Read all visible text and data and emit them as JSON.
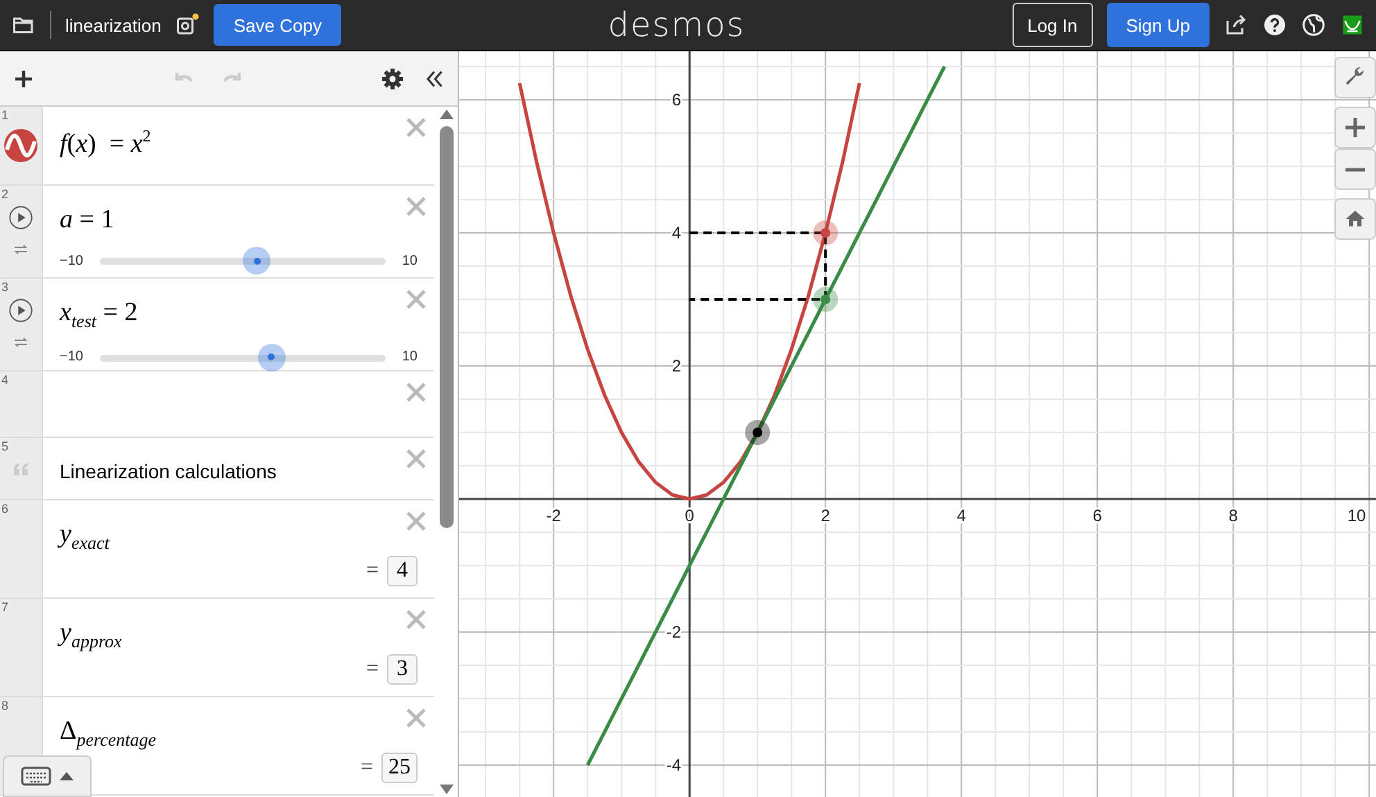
{
  "header": {
    "title": "linearization",
    "save_button": "Save Copy",
    "logo": "desmos",
    "login_button": "Log In",
    "signup_button": "Sign Up"
  },
  "expressions": [
    {
      "kind": "function",
      "number": "1",
      "expr": "*f*(*x*)  = *x*$^{2}$",
      "color": "#c74440"
    },
    {
      "kind": "slider",
      "number": "2",
      "expr": "*a* = 1",
      "min": "−10",
      "max": "10",
      "level": 0.55
    },
    {
      "kind": "slider",
      "number": "3",
      "expr": "*x*$_{test}$ = 2",
      "min": "−10",
      "max": "10",
      "level": 0.6
    },
    {
      "kind": "empty",
      "number": "4"
    },
    {
      "kind": "note",
      "number": "5",
      "text": "Linearization calculations"
    },
    {
      "kind": "value",
      "number": "6",
      "expr": "*y*$_{exact}$",
      "equals": "=",
      "value": "4"
    },
    {
      "kind": "value",
      "number": "7",
      "expr": "*y*$_{approx}$",
      "equals": "=",
      "value": "3"
    },
    {
      "kind": "value",
      "number": "8",
      "expr": "Δ$_{percentage}$",
      "equals": "=",
      "value": "25"
    }
  ],
  "graph": {
    "chart_data": {
      "type": "line",
      "x": [
        -2.5,
        -2.25,
        -2,
        -1.75,
        -1.5,
        -1.25,
        -1,
        -0.75,
        -0.5,
        -0.25,
        0,
        0.25,
        0.5,
        0.75,
        1,
        1.25,
        1.5,
        1.75,
        2,
        2.25,
        2.5,
        2.75,
        3,
        3.25,
        3.5,
        3.75
      ],
      "xlim": [
        -3.39,
        10.1
      ],
      "ylim": [
        -4.48,
        6.73
      ],
      "xticks": [
        -2,
        0,
        2,
        4,
        6,
        8,
        10
      ],
      "yticks": [
        -4,
        -2,
        2,
        4,
        6
      ],
      "grid": true,
      "series": [
        {
          "color": "#c74440",
          "values": [
            6.25,
            5.06,
            4,
            3.06,
            2.25,
            1.56,
            1,
            0.56,
            0.25,
            0.06,
            0,
            0.06,
            0.25,
            0.56,
            1,
            1.56,
            2.25,
            3.06,
            4,
            5.06,
            6.25,
            null,
            null,
            null,
            null,
            null
          ]
        },
        {
          "color": "#388c46",
          "values": [
            null,
            null,
            null,
            null,
            -4,
            -3.5,
            -3,
            -2.5,
            -2,
            -1.5,
            -1,
            -0.5,
            0,
            0.5,
            1,
            1.5,
            2,
            2.5,
            3,
            3.5,
            4,
            4.5,
            5,
            5.5,
            6,
            6.5
          ]
        }
      ]
    },
    "points": [
      {
        "color": "#000000"
      },
      {
        "color": "#c74440"
      },
      {
        "color": "#388c46"
      }
    ]
  }
}
